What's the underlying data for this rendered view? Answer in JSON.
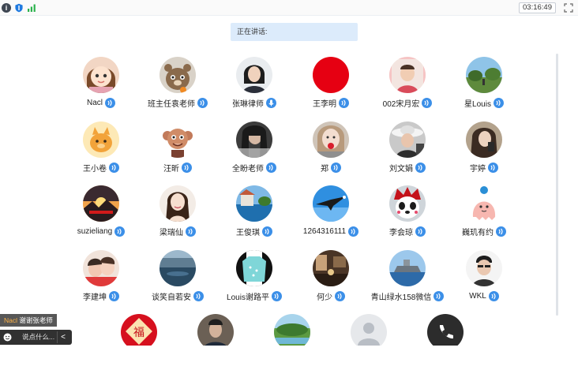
{
  "status_bar": {
    "timer": "03:16:49",
    "icons": [
      "info-icon",
      "shield-icon",
      "signal-icon",
      "fullscreen-icon"
    ]
  },
  "speaking": {
    "label": "正在讲话:"
  },
  "participants": [
    {
      "name": "Nacl",
      "avatar": "cartoon-girl",
      "mic": "voice"
    },
    {
      "name": "班主任袁老师",
      "avatar": "cat",
      "mic": "voice"
    },
    {
      "name": "张琳律师",
      "avatar": "woman-photo",
      "mic": "mic"
    },
    {
      "name": "王李明",
      "avatar": "red-circle",
      "mic": "voice"
    },
    {
      "name": "002宋月宏",
      "avatar": "child-photo",
      "mic": "voice"
    },
    {
      "name": "星Louis",
      "avatar": "landscape-photo",
      "mic": "voice"
    },
    {
      "name": "王小卷",
      "avatar": "cartoon-pig",
      "mic": "voice"
    },
    {
      "name": "汪昕",
      "avatar": "monkey-toy",
      "mic": "voice"
    },
    {
      "name": "全盼老师",
      "avatar": "woman-photo-2",
      "mic": "voice"
    },
    {
      "name": "郑",
      "avatar": "doll-photo",
      "mic": "voice"
    },
    {
      "name": "刘文娟",
      "avatar": "woman-hat",
      "mic": "voice"
    },
    {
      "name": "宇婷",
      "avatar": "woman-photo-3",
      "mic": "voice"
    },
    {
      "name": "suzieliang",
      "avatar": "sunset-photo",
      "mic": "voice"
    },
    {
      "name": "梁瑞仙",
      "avatar": "woman-portrait",
      "mic": "voice"
    },
    {
      "name": "王俊琪",
      "avatar": "seaside-photo",
      "mic": "voice"
    },
    {
      "name": "1264316111",
      "avatar": "eagle-sky",
      "mic": "voice"
    },
    {
      "name": "李会琼",
      "avatar": "panda-opera",
      "mic": "voice"
    },
    {
      "name": "巍玑有约",
      "avatar": "cartoon-ghost",
      "mic": "voice"
    },
    {
      "name": "李建坤",
      "avatar": "kids-photo",
      "mic": "voice"
    },
    {
      "name": "谈笑自若安",
      "avatar": "lake-photo",
      "mic": "voice"
    },
    {
      "name": "Louis谢路平",
      "avatar": "hoodie",
      "mic": "voice"
    },
    {
      "name": "何少",
      "avatar": "interior-photo",
      "mic": "voice"
    },
    {
      "name": "青山绿水158微信",
      "avatar": "ship-photo",
      "mic": "voice"
    },
    {
      "name": "WKL",
      "avatar": "man-photo",
      "mic": "voice"
    }
  ],
  "partial_row": [
    {
      "avatar": "fu-red",
      "text": "福"
    },
    {
      "avatar": "man-suit"
    },
    {
      "avatar": "park-photo"
    },
    {
      "avatar": "default-user"
    },
    {
      "avatar": "phone-dark"
    }
  ],
  "chat": {
    "from": "Nacl",
    "message": "谢谢张老师",
    "placeholder": "说点什么...",
    "collapse": "<"
  },
  "colors": {
    "mic_badge": "#3b8fe8",
    "banner": "#dcebfb",
    "accent_red": "#e60012"
  }
}
